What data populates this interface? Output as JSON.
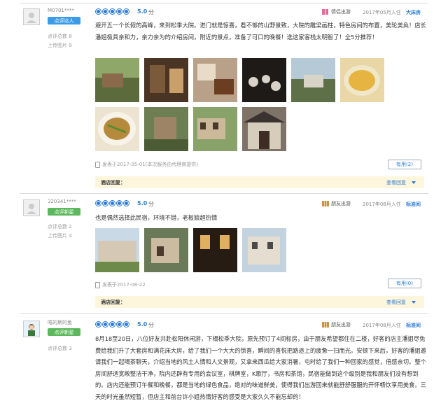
{
  "reviews": [
    {
      "username": "M0701****",
      "badge": "点评达人",
      "badge_color": "#3b9be6",
      "reviews_total": "点评总数 8",
      "photos_total": "上传图片 9",
      "score": "5.0",
      "score_unit": "分",
      "trip_type": "情侣出游",
      "stay_date": "2017年05月入住",
      "room_type": "大床房",
      "text": "避开五一个长假的高峰，来到松季大院。进门就是惊喜，看不够的山野景致，大院的雕梁画柱，特色房间的布置，美轮美奂！店长潘姐极具亲和力，亲力亲为的介绍房间，附近的景点，准备了可口的晚餐！选这家客栈太明智了！全5分推荐！",
      "photo_count": 10,
      "posted": "发表于2017-05-01(本次服务由代理商提供)",
      "useful": "有用(2)",
      "reply_label": "酒店回复：",
      "reply_link": "查看回复"
    },
    {
      "username": "320341****",
      "badge": "点评新星",
      "badge_color": "#5cb85c",
      "reviews_total": "点评总数 2",
      "photos_total": "上传图片 4",
      "score": "5.0",
      "score_unit": "分",
      "trip_type": "朋友出游",
      "stay_date": "2017年08月入住",
      "room_type": "标准间",
      "text": "也是偶然选择此民宿，环境不错，老板娘超热情",
      "photo_count": 4,
      "posted": "发表于2017-08-22",
      "useful": "有用(0)",
      "reply_label": "酒店回复：",
      "reply_link": "查看回复"
    },
    {
      "username": "哐的斯的鱼",
      "badge": "点评新星",
      "badge_color": "#5cb85c",
      "reviews_total": "点评总数 3",
      "score": "5.0",
      "score_unit": "分",
      "trip_type": "朋友出游",
      "stay_date": "2017年08月入住",
      "room_type": "标准间",
      "text": "8月18至20日，八位好友共赴松阳休闲游，下榻松季大院，原先预订了4间标房，由于朋友希望都住在二楼，好客的店主潘姐尽免费给我们升了大套房和满花床大房，给了我们一个大大的惊喜，瞬间的喜悦把路途上的疲惫一扫而光。安顿下来后，好客的潘姐邀请我们一起喝茶聊天，介绍当地的风土人情和人文景观，又拿来西瓜给大家消暑，屯时给了我们一种回家的感觉，倍感亲切。整个房间舒适宽敞整洁干净，院内还辟有专用的会议室，棋牌室，K歌厅，书房和茶馆，民宿能做到这个级别是我和朋友们没有想到的。店内还能预订午餐和晚餐，都是当地的绿色食品，绝对的味道鲜美，使得我们出游回来就能舒舒服服的开怀畅饮享用美食。三天的时光虽然短暂，但店主和前台许小姐热情好客的感受是大家久久不能忘却的！"
    }
  ]
}
